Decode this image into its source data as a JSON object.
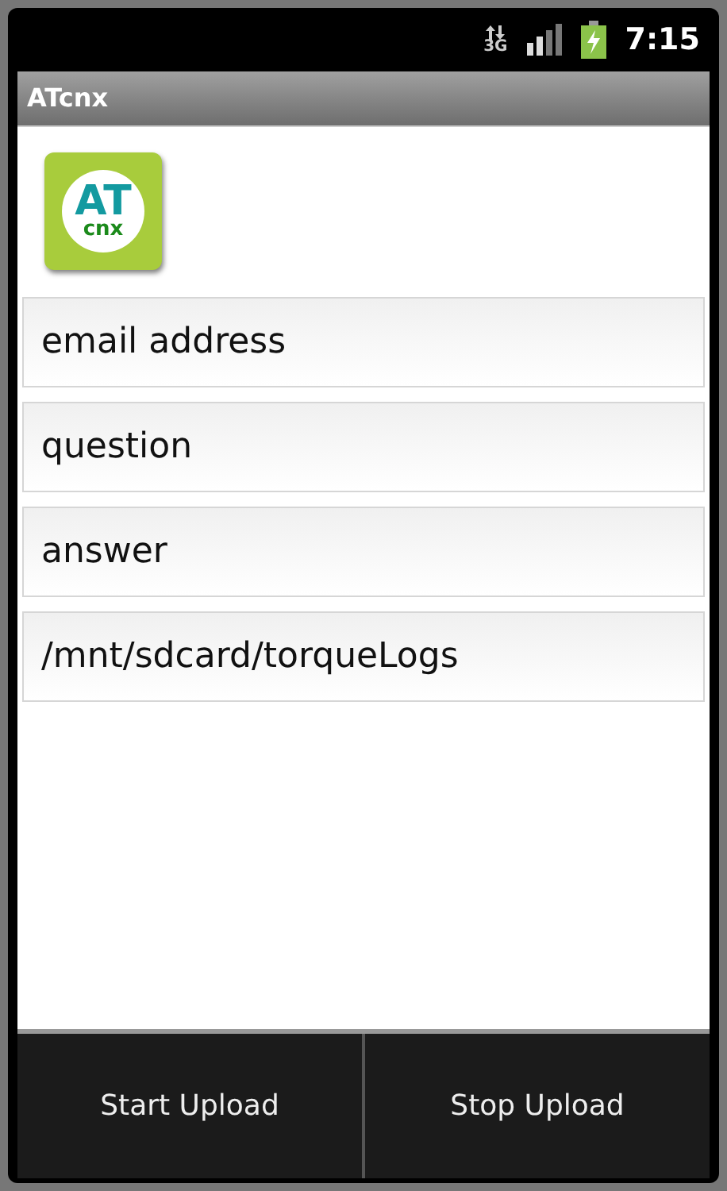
{
  "status_bar": {
    "network_type": "3G",
    "time": "7:15"
  },
  "app_bar": {
    "title": "ATcnx"
  },
  "logo": {
    "line_1": "AT",
    "line_2": "cnx"
  },
  "fields": [
    {
      "value": "email address"
    },
    {
      "value": "question"
    },
    {
      "value": "answer"
    },
    {
      "value": "/mnt/sdcard/torqueLogs"
    }
  ],
  "buttons": [
    "Start Upload",
    "Stop Upload"
  ]
}
